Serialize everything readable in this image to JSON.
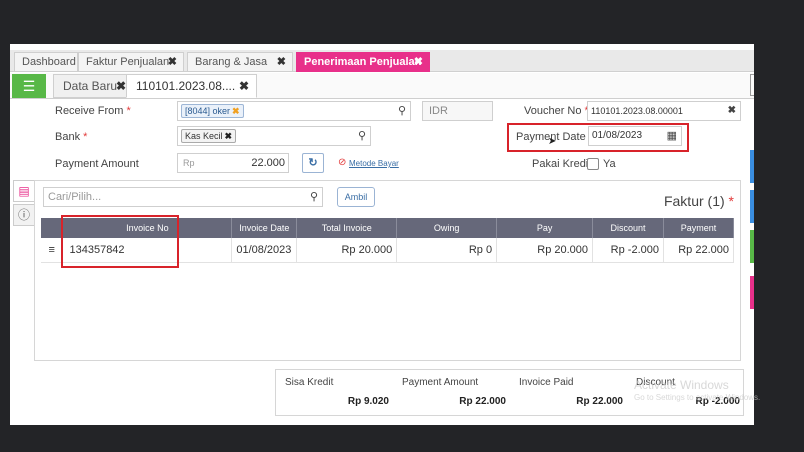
{
  "tabs": [
    {
      "label": "Dashboard",
      "close": ""
    },
    {
      "label": "Faktur Penjualan",
      "close": "✖"
    },
    {
      "label": "Barang & Jasa",
      "close": "✖"
    },
    {
      "label": "Penerimaan Penjualan",
      "close": "✖"
    }
  ],
  "subtabs": [
    {
      "label": "Data Baru",
      "close": "✖"
    },
    {
      "label": "110101.2023.08....",
      "close": "✖"
    }
  ],
  "form": {
    "receive_from_label": "Receive From",
    "receive_from_chip": "[8044] oker",
    "chip_remove": "✖",
    "currency": "IDR",
    "voucher_no_label": "Voucher No",
    "voucher_no_value": "110101.2023.08.00001",
    "bank_label": "Bank",
    "bank_chip": "Kas Kecil",
    "payment_date_label": "Payment Date",
    "payment_date_value": "01/08/2023",
    "payment_amount_label": "Payment Amount",
    "payment_amount_prefix": "Rp",
    "payment_amount_value": "22.000",
    "metode_bayar": "Metode Bayar",
    "pakai_kredit_label": "Pakai Kredit",
    "ya_label": "Ya",
    "required_mark": "*",
    "close_x": "✖"
  },
  "panel": {
    "search_placeholder": "Cari/Pilih...",
    "ambil_label": "Ambil",
    "faktur_title": "Faktur (1)",
    "columns": [
      "Invoice No",
      "Invoice Date",
      "Total Invoice",
      "Owing",
      "Pay",
      "Discount",
      "Payment"
    ],
    "rows": [
      {
        "invoice_no": "134357842",
        "invoice_date": "01/08/2023",
        "total_invoice": "Rp 20.000",
        "owing": "Rp 0",
        "pay": "Rp 20.000",
        "discount": "Rp -2.000",
        "payment": "Rp 22.000"
      }
    ]
  },
  "summary": [
    {
      "label": "Sisa Kredit",
      "value": "Rp 9.020"
    },
    {
      "label": "Payment Amount",
      "value": "Rp 22.000"
    },
    {
      "label": "Invoice Paid",
      "value": "Rp 22.000"
    },
    {
      "label": "Discount",
      "value": "Rp -2.000"
    }
  ],
  "watermark": {
    "line1": "Activate Windows",
    "line2": "Go to Settings to activate Windows."
  },
  "colors": {
    "accent": "#e8308a",
    "green": "#58b847",
    "header": "#66687a",
    "highlight": "#d8232a"
  },
  "icons": [
    "list-icon",
    "search-icon",
    "calendar-icon",
    "refresh-icon",
    "warning-icon",
    "document-icon",
    "info-icon",
    "drag-handle-icon"
  ]
}
